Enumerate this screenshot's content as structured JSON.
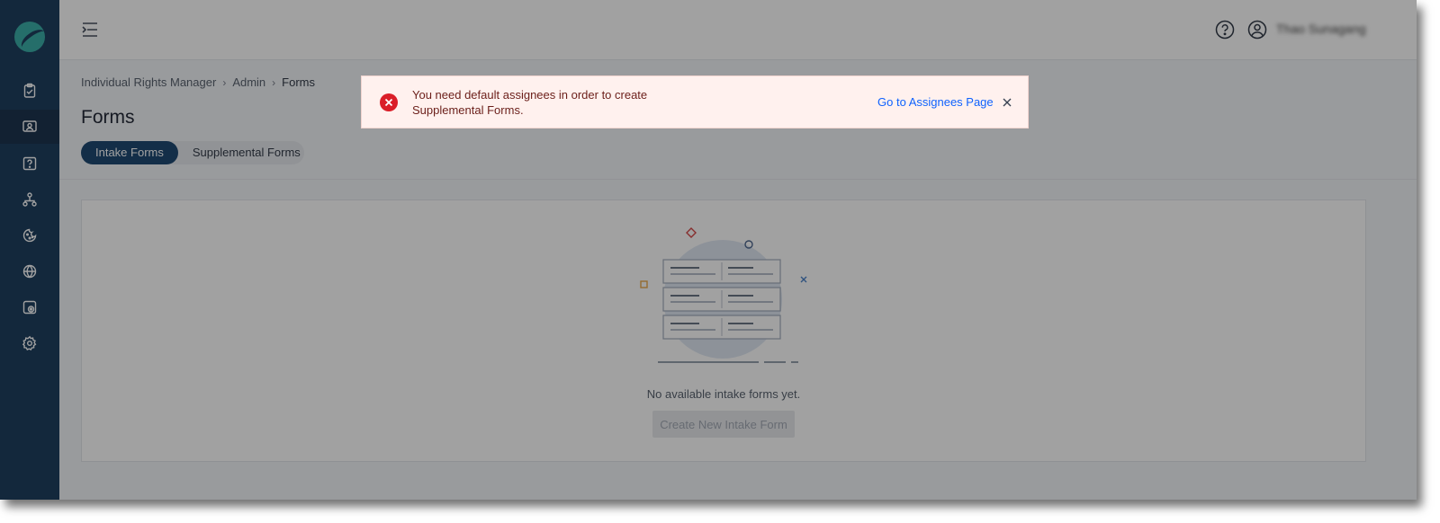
{
  "header": {
    "user_name": "Thao Sunagang"
  },
  "breadcrumb": [
    "Individual Rights Manager",
    "Admin",
    "Forms"
  ],
  "page": {
    "title": "Forms",
    "tabs": [
      {
        "label": "Intake Forms",
        "active": true
      },
      {
        "label": "Supplemental Forms",
        "active": false
      }
    ]
  },
  "empty_state": {
    "message": "No available intake forms yet.",
    "button_label": "Create New Intake Form"
  },
  "toast": {
    "message": "You need default assignees in order to create Supplemental Forms.",
    "link_label": "Go to Assignees Page"
  },
  "sidebar": {
    "items": [
      {
        "icon": "clipboard-check-icon"
      },
      {
        "icon": "user-screen-icon",
        "active": true
      },
      {
        "icon": "help-box-icon"
      },
      {
        "icon": "hierarchy-icon"
      },
      {
        "icon": "cookie-icon"
      },
      {
        "icon": "globe-icon"
      },
      {
        "icon": "data-disk-icon"
      },
      {
        "icon": "gear-icon"
      }
    ]
  },
  "colors": {
    "sidebar_bg": "#0b2f52",
    "active_tab": "#0b3a66",
    "error_red": "#da1e28",
    "link_blue": "#0f62fe",
    "toast_bg": "#fff1ee"
  }
}
